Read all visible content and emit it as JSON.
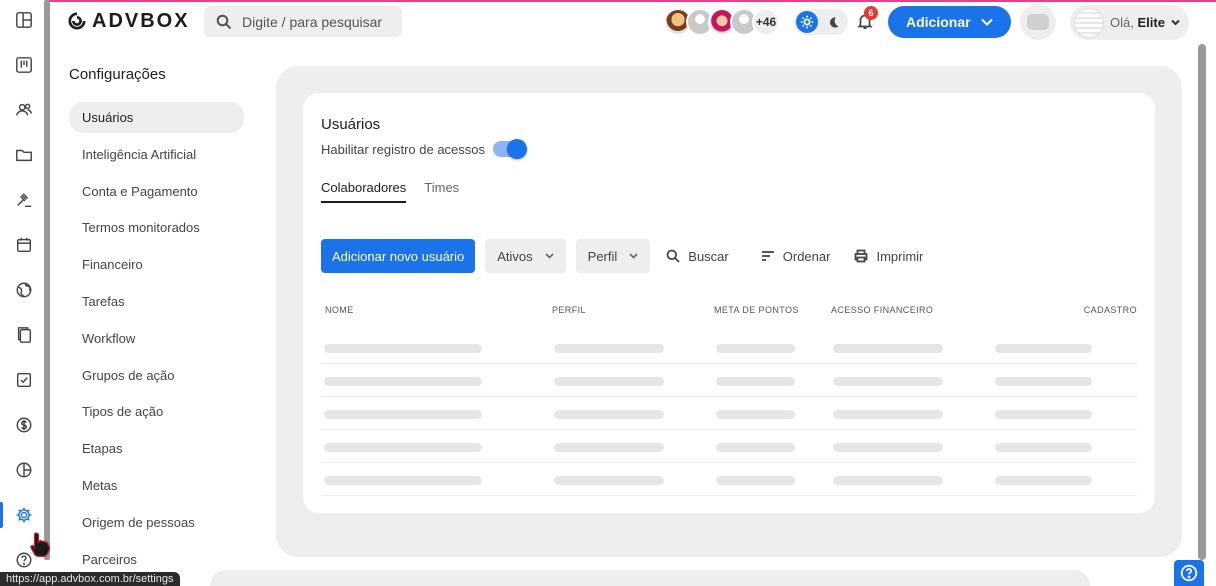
{
  "header": {
    "logo_text": "ADVBOX",
    "search_placeholder": "Digite / para pesquisar",
    "avatars_more": "+46",
    "notification_count": "6",
    "add_button": "Adicionar",
    "user_greeting": "Olá,",
    "user_name": "Elite"
  },
  "settings_nav": {
    "title": "Configurações",
    "items": [
      {
        "label": "Usuários",
        "active": true
      },
      {
        "label": "Inteligência Artificial"
      },
      {
        "label": "Conta e Pagamento"
      },
      {
        "label": "Termos monitorados"
      },
      {
        "label": "Financeiro"
      },
      {
        "label": "Tarefas"
      },
      {
        "label": "Workflow"
      },
      {
        "label": "Grupos de ação"
      },
      {
        "label": "Tipos de ação"
      },
      {
        "label": "Etapas"
      },
      {
        "label": "Metas"
      },
      {
        "label": "Origem de pessoas"
      },
      {
        "label": "Parceiros"
      }
    ]
  },
  "main": {
    "title": "Usuários",
    "access_log_label": "Habilitar registro de acessos",
    "access_log_enabled": true,
    "tabs": [
      {
        "label": "Colaboradores",
        "active": true
      },
      {
        "label": "Times"
      }
    ],
    "toolbar": {
      "add_user": "Adicionar novo usuário",
      "status_select": "Ativos",
      "profile_select": "Perfil",
      "search": "Buscar",
      "sort": "Ordenar",
      "print": "Imprimir"
    },
    "table": {
      "columns": [
        "NOME",
        "PERFIL",
        "META DE PONTOS",
        "ACESSO FINANCEIRO",
        "CADASTRO"
      ],
      "loading_rows": 5
    }
  },
  "status_bar_url": "https://app.advbox.com.br/settings",
  "colors": {
    "accent": "#1a73e8",
    "badge": "#e53935",
    "top_line": "#e83e8c"
  },
  "icons": [
    "layout-icon",
    "kanban-icon",
    "people-icon",
    "folder-icon",
    "gavel-icon",
    "calendar-icon",
    "globe-icon",
    "documents-icon",
    "checkbox-icon",
    "dollar-icon",
    "chart-pie-icon",
    "gear-icon",
    "help-icon"
  ]
}
